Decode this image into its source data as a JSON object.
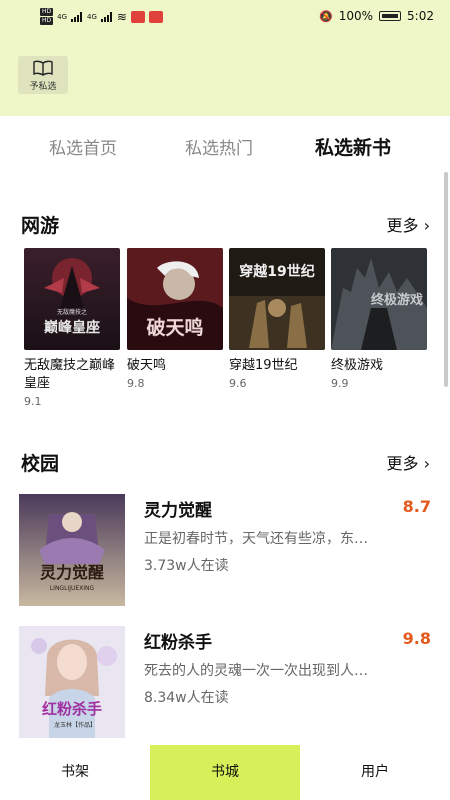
{
  "status_bar": {
    "battery": "100%",
    "time": "5:02",
    "network": "4G"
  },
  "header": {
    "logo_label": "予私选"
  },
  "tabs": [
    {
      "label": "私选首页",
      "active": false
    },
    {
      "label": "私选热门",
      "active": false
    },
    {
      "label": "私选新书",
      "active": true
    }
  ],
  "section_online": {
    "title": "网游",
    "more": "更多 ›",
    "books": [
      {
        "title": "无敌魔技之巅峰皇座",
        "score": "9.1",
        "cover_text": "巅峰皇座",
        "cover_sub": "无敌魔技之"
      },
      {
        "title": "破天鸣",
        "score": "9.8",
        "cover_text": "破天鸣"
      },
      {
        "title": "穿越19世纪",
        "score": "9.6",
        "cover_text": "穿越19世纪"
      },
      {
        "title": "终极游戏",
        "score": "9.9",
        "cover_text": "终极游戏"
      }
    ]
  },
  "section_campus": {
    "title": "校园",
    "more": "更多 ›",
    "books": [
      {
        "title": "灵力觉醒",
        "score": "8.7",
        "desc": "正是初春时节，天气还有些凉，东…",
        "readers": "3.73w人在读",
        "cover_text": "灵力觉醒",
        "cover_sub": "LINGLIJUEXING"
      },
      {
        "title": "红粉杀手",
        "score": "9.8",
        "desc": "死去的人的灵魂一次一次出现到人…",
        "readers": "8.34w人在读",
        "cover_text": "红粉杀手",
        "cover_sub": "龙玉林【作品】"
      }
    ]
  },
  "bottom_nav": [
    {
      "label": "书架",
      "active": false
    },
    {
      "label": "书城",
      "active": true
    },
    {
      "label": "用户",
      "active": false
    }
  ],
  "colors": {
    "header_bg": "#eff6c8",
    "accent": "#d7ef58",
    "score": "#e35a1c"
  }
}
